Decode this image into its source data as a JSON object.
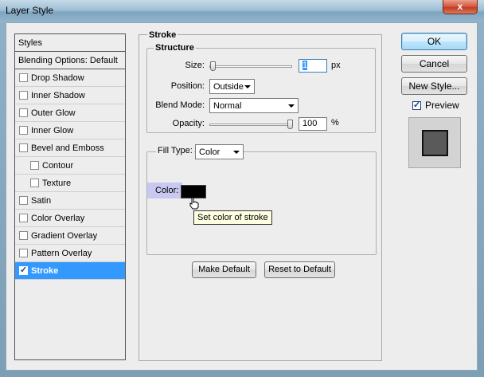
{
  "window": {
    "title": "Layer Style",
    "close_label": "x"
  },
  "styles_panel": {
    "header": "Styles",
    "blending": "Blending Options: Default",
    "items": [
      {
        "label": "Drop Shadow",
        "checked": false,
        "indent": false
      },
      {
        "label": "Inner Shadow",
        "checked": false,
        "indent": false
      },
      {
        "label": "Outer Glow",
        "checked": false,
        "indent": false
      },
      {
        "label": "Inner Glow",
        "checked": false,
        "indent": false
      },
      {
        "label": "Bevel and Emboss",
        "checked": false,
        "indent": false
      },
      {
        "label": "Contour",
        "checked": false,
        "indent": true
      },
      {
        "label": "Texture",
        "checked": false,
        "indent": true
      },
      {
        "label": "Satin",
        "checked": false,
        "indent": false
      },
      {
        "label": "Color Overlay",
        "checked": false,
        "indent": false
      },
      {
        "label": "Gradient Overlay",
        "checked": false,
        "indent": false
      },
      {
        "label": "Pattern Overlay",
        "checked": false,
        "indent": false
      },
      {
        "label": "Stroke",
        "checked": true,
        "indent": false,
        "selected": true
      }
    ]
  },
  "stroke": {
    "section_title": "Stroke",
    "structure": {
      "title": "Structure",
      "size_label": "Size:",
      "size_value": "1",
      "size_unit": "px",
      "position_label": "Position:",
      "position_value": "Outside",
      "blend_mode_label": "Blend Mode:",
      "blend_mode_value": "Normal",
      "opacity_label": "Opacity:",
      "opacity_value": "100",
      "opacity_unit": "%"
    },
    "fill": {
      "fill_type_label": "Fill Type:",
      "fill_type_value": "Color",
      "color_label": "Color:",
      "color_value": "#000000",
      "tooltip": "Set color of stroke"
    },
    "make_default": "Make Default",
    "reset_default": "Reset to Default"
  },
  "actions": {
    "ok": "OK",
    "cancel": "Cancel",
    "new_style": "New Style...",
    "preview_label": "Preview",
    "preview_checked": true
  },
  "colors": {
    "selection": "#3399ff",
    "color_label_highlight": "#c8c8f0",
    "preview_swatch": "#5a5a5a"
  }
}
